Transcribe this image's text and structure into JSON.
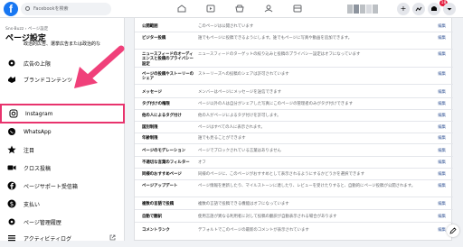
{
  "topbar": {
    "logo": "f",
    "search_placeholder": "Facebookを検索",
    "notification_count": "18"
  },
  "sidebar": {
    "breadcrumb": "Sns-Buzz › ページ設定",
    "title": "ページ設定",
    "cut_item": "政治的広告、選挙広告または政治的な",
    "items": [
      {
        "label": "広告の上限"
      },
      {
        "label": "ブランドコンテンツ"
      },
      {
        "label": "Instagram"
      },
      {
        "label": "WhatsApp"
      },
      {
        "label": "注目"
      },
      {
        "label": "クロス投稿"
      },
      {
        "label": "ページサポート受信箱"
      },
      {
        "label": "支払い"
      },
      {
        "label": "ページ管理履歴"
      },
      {
        "label": "アクティビティログ"
      }
    ],
    "highlight_color": "#e8336d"
  },
  "settings": {
    "edit_label": "編集",
    "rows": [
      {
        "key": "公開範囲",
        "value": "このページは公開されています"
      },
      {
        "key": "ビジター投稿",
        "value": "誰でもページに投稿できるようにします。誰でもページに写真や動画を追加できます。"
      },
      {
        "key": "ニュースフィードのオーディエンスと投稿のプライバシー設定",
        "value": "ニュースフィードのターゲットの絞り込みと投稿のプライバシー設定はオフになっています"
      },
      {
        "key": "ページの投稿やストーリーのシェア",
        "value": "ストーリーズへの投稿のシェアは許可されています"
      },
      {
        "key": "メッセージ",
        "value": "メンバーはページにメッセージを送信できます"
      },
      {
        "key": "タグ付けの権限",
        "value": "ページ以外の人は自分がシェアした写真にこのページの管理者のみがタグ付けできます"
      },
      {
        "key": "他の人によるタグ付け",
        "value": "他の人がページによるタグ付けを許可します。"
      },
      {
        "key": "国別制限",
        "value": "ページはすべての人に表示されます。"
      },
      {
        "key": "年齢制限",
        "value": "誰でも見ることができます"
      },
      {
        "key": "ページのモデレーション",
        "value": "ページでブロックされている言葉はありません"
      },
      {
        "key": "不適切な言葉のフィルター",
        "value": "オフ"
      },
      {
        "key": "同様のおすすめページ",
        "value": "同様のページに、このページがおすすめとして表示されるようにするかどうかを選択できます"
      },
      {
        "key": "ページアップデート",
        "value": "ページ情報を更新したり、マイルストーンに達したり、レビューを受けたりすると、自動的にページ投稿が公開されます。"
      },
      {
        "key": "複数の言語で投稿",
        "value": "複数の言語で投稿できる機能はオフになっています"
      },
      {
        "key": "自動で翻訳",
        "value": "使用言語が異なる利用者に対して投稿の翻訳が自動表示される場合があります"
      },
      {
        "key": "コメントランク",
        "value": "デフォルトでこのページの最新のコメントが表示されています"
      }
    ]
  }
}
